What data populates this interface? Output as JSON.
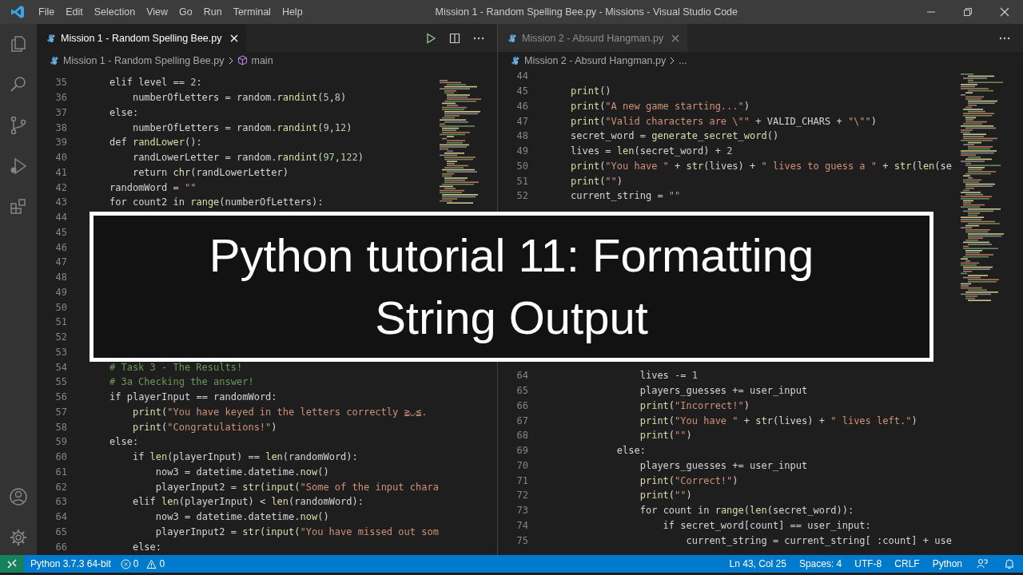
{
  "window": {
    "title": "Mission 1 - Random Spelling Bee.py - Missions - Visual Studio Code"
  },
  "menu": [
    "File",
    "Edit",
    "Selection",
    "View",
    "Go",
    "Run",
    "Terminal",
    "Help"
  ],
  "editors": [
    {
      "focused": true,
      "tab": {
        "label": "Mission 1 - Random Spelling Bee.py"
      },
      "breadcrumbs": [
        {
          "kind": "file",
          "text": "Mission 1 - Random Spelling Bee.py"
        },
        {
          "kind": "symbol",
          "text": "main"
        }
      ],
      "blocks": [
        {
          "lines": [
            {
              "number": "35",
              "code": "elif level == 2:"
            },
            {
              "number": "36",
              "code": "    numberOfLetters = random.randint(5,8)"
            },
            {
              "number": "37",
              "code": "else:"
            },
            {
              "number": "38",
              "code": "    numberOfLetters = random.randint(9,12)"
            },
            {
              "number": "39",
              "code": "def randLower():"
            },
            {
              "number": "40",
              "code": "    randLowerLetter = random.randint(97,122)"
            },
            {
              "number": "41",
              "code": "    return chr(randLowerLetter)"
            },
            {
              "number": "42",
              "code": "randomWord = \"\""
            },
            {
              "number": "43",
              "code": "for count2 in range(numberOfLetters):"
            },
            {
              "number": "44"
            },
            {
              "number": "45"
            },
            {
              "number": "46"
            },
            {
              "number": "47"
            },
            {
              "number": "48"
            },
            {
              "number": "49"
            },
            {
              "number": "50"
            },
            {
              "number": "51"
            },
            {
              "number": "52"
            },
            {
              "number": "53"
            },
            {
              "number": "54",
              "code": "# Task 3 - The Results!"
            },
            {
              "number": "55",
              "code": "# 3a Checking the answer!"
            },
            {
              "number": "56",
              "code": "if playerInput == randomWord:"
            },
            {
              "number": "57",
              "code": "    print(\"You have keyed in the letters correctly ≧◡≦."
            },
            {
              "number": "58",
              "code": "    print(\"Congratulations!\")"
            },
            {
              "number": "59",
              "code": "else:"
            },
            {
              "number": "60",
              "code": "    if len(playerInput) == len(randomWord):"
            },
            {
              "number": "61",
              "code": "        now3 = datetime.datetime.now()"
            },
            {
              "number": "62",
              "code": "        playerInput2 = str(input(\"Some of the input chara"
            },
            {
              "number": "63",
              "code": "    elif len(playerInput) < len(randomWord):"
            },
            {
              "number": "64",
              "code": "        now3 = datetime.datetime.now()"
            },
            {
              "number": "65",
              "code": "        playerInput2 = str(input(\"You have missed out som"
            },
            {
              "number": "66",
              "code": "    else:"
            }
          ]
        }
      ]
    },
    {
      "focused": false,
      "tab": {
        "label": "Mission 2 - Absurd Hangman.py"
      },
      "breadcrumbs": [
        {
          "kind": "file",
          "text": "Mission 2 - Absurd Hangman.py"
        },
        {
          "kind": "more",
          "text": "..."
        }
      ],
      "blocks": [
        {
          "lines": [
            {
              "number": "44"
            },
            {
              "number": "45",
              "code": "print()"
            },
            {
              "number": "46",
              "code": "print(\"A new game starting...\")"
            },
            {
              "number": "47",
              "code": "print(\"Valid characters are \\\"\" + VALID_CHARS + \"\\\"\")"
            },
            {
              "number": "48",
              "code": "secret_word = generate_secret_word()"
            },
            {
              "number": "49",
              "code": "lives = len(secret_word) + 2"
            },
            {
              "number": "50",
              "code": "print(\"You have \" + str(lives) + \" lives to guess a \" + str(len(se"
            },
            {
              "number": "51",
              "code": "print(\"\")"
            },
            {
              "number": "52",
              "code": "current_string = \"\""
            }
          ]
        },
        {
          "lines": [
            {
              "number": "64",
              "code": "            lives -= 1"
            },
            {
              "number": "65",
              "code": "            players_guesses += user_input"
            },
            {
              "number": "66",
              "code": "            print(\"Incorrect!\")"
            },
            {
              "number": "67",
              "code": "            print(\"You have \" + str(lives) + \" lives left.\")"
            },
            {
              "number": "68",
              "code": "            print(\"\")"
            },
            {
              "number": "69",
              "code": "        else:"
            },
            {
              "number": "70",
              "code": "            players_guesses += user_input"
            },
            {
              "number": "71",
              "code": "            print(\"Correct!\")"
            },
            {
              "number": "72",
              "code": "            print(\"\")"
            },
            {
              "number": "73",
              "code": "            for count in range(len(secret_word)):"
            },
            {
              "number": "74",
              "code": "                if secret_word[count] == user_input:"
            },
            {
              "number": "75",
              "code": "                    current_string = current_string[ :count] + use"
            }
          ]
        }
      ]
    }
  ],
  "banner": {
    "title_lines": [
      "Python tutorial 11: Formatting",
      "String Output"
    ]
  },
  "status_bar": {
    "left": [
      {
        "kind": "text",
        "text": "Python 3.7.3 64-bit"
      },
      {
        "kind": "errors",
        "text": "0"
      },
      {
        "kind": "warnings",
        "text": "0"
      }
    ],
    "right": [
      "Ln 43, Col 25",
      "Spaces: 4",
      "UTF-8",
      "CRLF",
      "Python"
    ]
  }
}
